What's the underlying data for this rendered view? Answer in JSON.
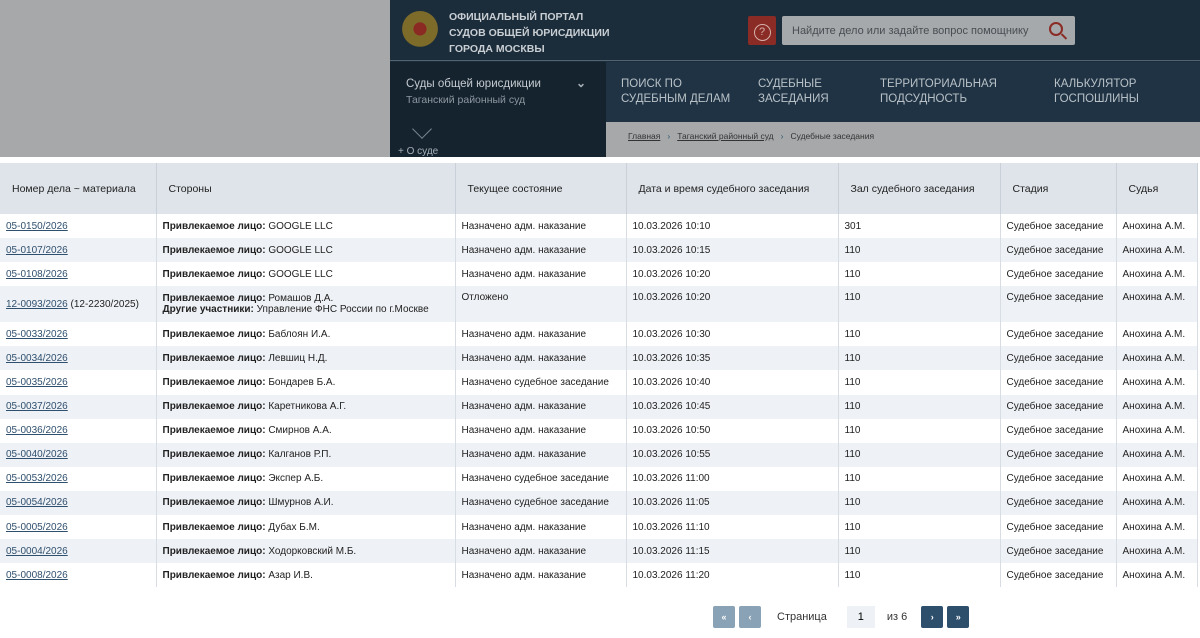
{
  "header": {
    "portal_title": [
      "ОФИЦИАЛЬНЫЙ ПОРТАЛ",
      "СУДОВ ОБЩЕЙ ЮРИСДИКЦИИ",
      "ГОРОДА МОСКВЫ"
    ],
    "search_placeholder": "Найдите дело или задайте вопрос помощнику",
    "help_icon": "?"
  },
  "nav": {
    "court_label": "Суды общей юрисдикции",
    "court_name": "Таганский районный суд",
    "about": "+ О суде",
    "items": [
      [
        "ПОИСК ПО",
        "СУДЕБНЫМ ДЕЛАМ"
      ],
      [
        "СУДЕБНЫЕ",
        "ЗАСЕДАНИЯ"
      ],
      [
        "ТЕРРИТОРИАЛЬНАЯ",
        "ПОДСУДНОСТЬ"
      ],
      [
        "КАЛЬКУЛЯТОР",
        "ГОСПОШЛИНЫ"
      ]
    ]
  },
  "breadcrumb": [
    "Главная",
    "Таганский районный суд",
    "Судебные заседания"
  ],
  "table": {
    "columns": [
      "Номер дела ~ материала",
      "Стороны",
      "Текущее состояние",
      "Дата и время судебного заседания",
      "Зал судебного заседания",
      "Стадия",
      "Судья"
    ],
    "rows": [
      {
        "case": "05-0150/2026",
        "extra": "",
        "party_label": "Привлекаемое лицо:",
        "party": "GOOGLE LLC",
        "other_label": "",
        "other": "",
        "state": "Назначено адм. наказание",
        "datetime": "10.03.2026 10:10",
        "room": "301",
        "stage": "Судебное заседание",
        "judge": "Анохина А.М."
      },
      {
        "case": "05-0107/2026",
        "extra": "",
        "party_label": "Привлекаемое лицо:",
        "party": "GOOGLE LLC",
        "other_label": "",
        "other": "",
        "state": "Назначено адм. наказание",
        "datetime": "10.03.2026 10:15",
        "room": "110",
        "stage": "Судебное заседание",
        "judge": "Анохина А.М."
      },
      {
        "case": "05-0108/2026",
        "extra": "",
        "party_label": "Привлекаемое лицо:",
        "party": "GOOGLE LLC",
        "other_label": "",
        "other": "",
        "state": "Назначено адм. наказание",
        "datetime": "10.03.2026 10:20",
        "room": "110",
        "stage": "Судебное заседание",
        "judge": "Анохина А.М."
      },
      {
        "case": "12-0093/2026",
        "extra": " (12-2230/2025)",
        "party_label": "Привлекаемое лицо:",
        "party": "Ромашов Д.А.",
        "other_label": "Другие участники:",
        "other": "Управление ФНС России по г.Москве",
        "state": "Отложено",
        "datetime": "10.03.2026 10:20",
        "room": "110",
        "stage": "Судебное заседание",
        "judge": "Анохина А.М."
      },
      {
        "case": "05-0033/2026",
        "extra": "",
        "party_label": "Привлекаемое лицо:",
        "party": "Баблоян И.А.",
        "other_label": "",
        "other": "",
        "state": "Назначено адм. наказание",
        "datetime": "10.03.2026 10:30",
        "room": "110",
        "stage": "Судебное заседание",
        "judge": "Анохина А.М."
      },
      {
        "case": "05-0034/2026",
        "extra": "",
        "party_label": "Привлекаемое лицо:",
        "party": "Левшиц Н.Д.",
        "other_label": "",
        "other": "",
        "state": "Назначено адм. наказание",
        "datetime": "10.03.2026 10:35",
        "room": "110",
        "stage": "Судебное заседание",
        "judge": "Анохина А.М."
      },
      {
        "case": "05-0035/2026",
        "extra": "",
        "party_label": "Привлекаемое лицо:",
        "party": "Бондарев Б.А.",
        "other_label": "",
        "other": "",
        "state": "Назначено судебное заседание",
        "datetime": "10.03.2026 10:40",
        "room": "110",
        "stage": "Судебное заседание",
        "judge": "Анохина А.М."
      },
      {
        "case": "05-0037/2026",
        "extra": "",
        "party_label": "Привлекаемое лицо:",
        "party": "Каретникова А.Г.",
        "other_label": "",
        "other": "",
        "state": "Назначено адм. наказание",
        "datetime": "10.03.2026 10:45",
        "room": "110",
        "stage": "Судебное заседание",
        "judge": "Анохина А.М."
      },
      {
        "case": "05-0036/2026",
        "extra": "",
        "party_label": "Привлекаемое лицо:",
        "party": "Смирнов А.А.",
        "other_label": "",
        "other": "",
        "state": "Назначено адм. наказание",
        "datetime": "10.03.2026 10:50",
        "room": "110",
        "stage": "Судебное заседание",
        "judge": "Анохина А.М."
      },
      {
        "case": "05-0040/2026",
        "extra": "",
        "party_label": "Привлекаемое лицо:",
        "party": "Калганов Р.П.",
        "other_label": "",
        "other": "",
        "state": "Назначено адм. наказание",
        "datetime": "10.03.2026 10:55",
        "room": "110",
        "stage": "Судебное заседание",
        "judge": "Анохина А.М."
      },
      {
        "case": "05-0053/2026",
        "extra": "",
        "party_label": "Привлекаемое лицо:",
        "party": "Экспер А.Б.",
        "other_label": "",
        "other": "",
        "state": "Назначено судебное заседание",
        "datetime": "10.03.2026 11:00",
        "room": "110",
        "stage": "Судебное заседание",
        "judge": "Анохина А.М."
      },
      {
        "case": "05-0054/2026",
        "extra": "",
        "party_label": "Привлекаемое лицо:",
        "party": "Шмурнов А.И.",
        "other_label": "",
        "other": "",
        "state": "Назначено судебное заседание",
        "datetime": "10.03.2026 11:05",
        "room": "110",
        "stage": "Судебное заседание",
        "judge": "Анохина А.М."
      },
      {
        "case": "05-0005/2026",
        "extra": "",
        "party_label": "Привлекаемое лицо:",
        "party": "Дубах Б.М.",
        "other_label": "",
        "other": "",
        "state": "Назначено адм. наказание",
        "datetime": "10.03.2026 11:10",
        "room": "110",
        "stage": "Судебное заседание",
        "judge": "Анохина А.М."
      },
      {
        "case": "05-0004/2026",
        "extra": "",
        "party_label": "Привлекаемое лицо:",
        "party": "Ходорковский М.Б.",
        "other_label": "",
        "other": "",
        "state": "Назначено адм. наказание",
        "datetime": "10.03.2026 11:15",
        "room": "110",
        "stage": "Судебное заседание",
        "judge": "Анохина А.М."
      },
      {
        "case": "05-0008/2026",
        "extra": "",
        "party_label": "Привлекаемое лицо:",
        "party": "Азар И.В.",
        "other_label": "",
        "other": "",
        "state": "Назначено адм. наказание",
        "datetime": "10.03.2026 11:20",
        "room": "110",
        "stage": "Судебное заседание",
        "judge": "Анохина А.М."
      }
    ]
  },
  "pagination": {
    "first": "«",
    "prev": "‹",
    "label": "Страница",
    "current": "1",
    "of": "из 6",
    "next": "›",
    "last": "»"
  }
}
